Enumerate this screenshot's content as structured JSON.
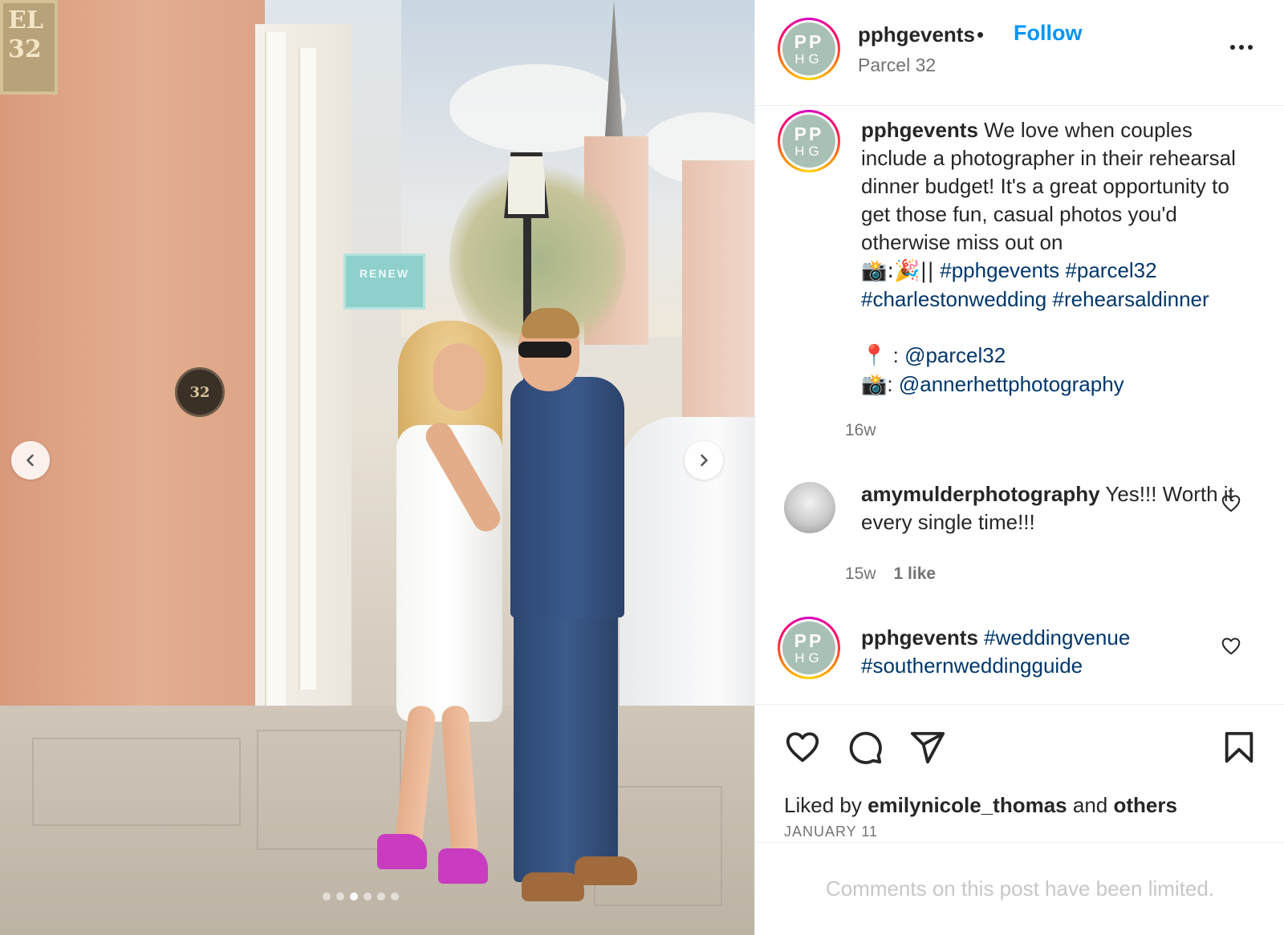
{
  "photo": {
    "plaque_text": "EL\n32",
    "medallion_text": "32",
    "shop_sign_text": "RENEW",
    "carousel": {
      "total": 6,
      "active_index": 2
    }
  },
  "header": {
    "username": "pphgevents",
    "separator": "•",
    "follow_label": "Follow",
    "location": "Parcel 32",
    "avatar_text_top": "PP",
    "avatar_text_bottom": "HG"
  },
  "caption": {
    "username": "pphgevents",
    "text": "We love when couples include a photographer in their rehearsal dinner budget! It's a great opportunity to get those fun, casual photos you'd otherwise miss out on",
    "emoji_line_prefix": "📸:🎉||",
    "hashtags": [
      "#pphgevents",
      "#parcel32",
      "#charlestonwedding",
      "#rehearsaldinner"
    ],
    "location_line": {
      "emoji": "📍",
      "separator": ":",
      "mention": "@parcel32"
    },
    "photo_line": {
      "emoji": "📸",
      "separator": ":",
      "mention": "@annerhettphotography"
    },
    "age": "16w"
  },
  "comments": [
    {
      "username": "amymulderphotography",
      "text": "Yes!!! Worth it every single time!!!",
      "age": "15w",
      "likes": "1 like"
    },
    {
      "username": "pphgevents",
      "hashtags": [
        "#weddingvenue",
        "#southernweddingguide"
      ]
    }
  ],
  "actions": {
    "icons": [
      "heart-icon",
      "comment-icon",
      "share-icon",
      "bookmark-icon"
    ],
    "liked_prefix": "Liked by",
    "liked_user": "emilynicole_thomas",
    "liked_and": "and",
    "liked_others": "others",
    "date": "JANUARY 11"
  },
  "footer": {
    "limited_text": "Comments on this post have been limited."
  },
  "colors": {
    "follow_blue": "#0095f6",
    "hashtag_blue": "#00376b",
    "avatar_green": "#a9c0b5",
    "heel_magenta": "#c93cc0"
  }
}
